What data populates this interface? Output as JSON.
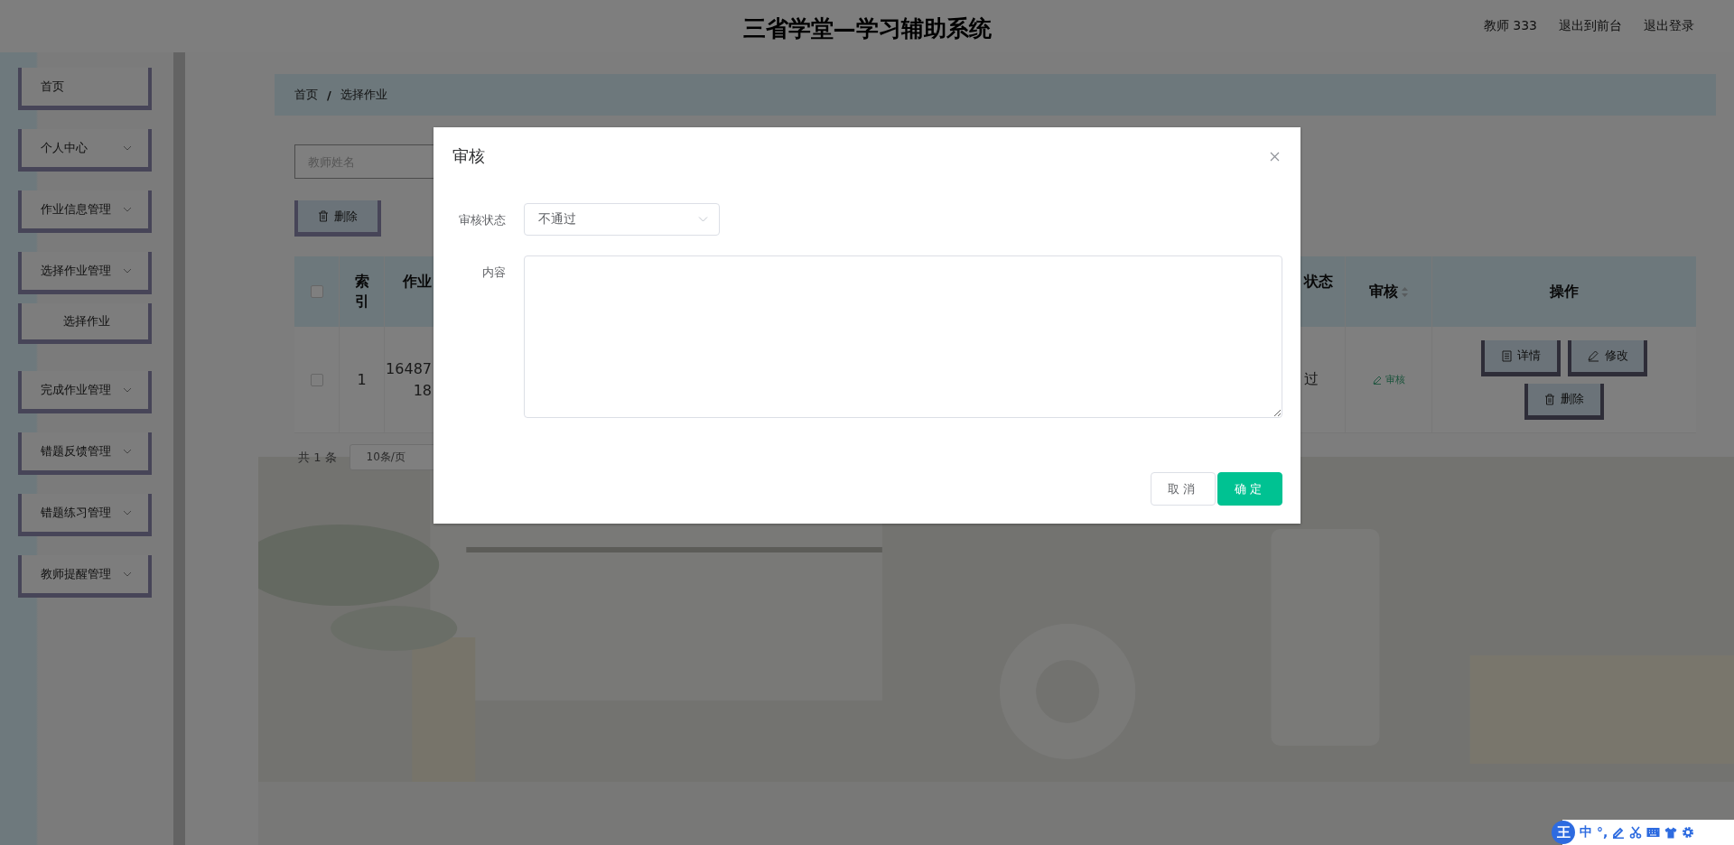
{
  "header": {
    "title": "三省学堂—学习辅助系统",
    "user": "教师 333",
    "links": [
      "退出到前台",
      "退出登录"
    ]
  },
  "sidebar": {
    "items": [
      {
        "label": "首页",
        "kind": "link"
      },
      {
        "label": "个人中心",
        "kind": "menu"
      },
      {
        "label": "作业信息管理",
        "kind": "menu"
      },
      {
        "label": "选择作业管理",
        "kind": "menu",
        "children": [
          {
            "label": "选择作业"
          }
        ]
      },
      {
        "label": "完成作业管理",
        "kind": "menu"
      },
      {
        "label": "错题反馈管理",
        "kind": "menu"
      },
      {
        "label": "错题练习管理",
        "kind": "menu"
      },
      {
        "label": "教师提醒管理",
        "kind": "menu"
      }
    ]
  },
  "breadcrumb": {
    "items": [
      "首页",
      "选择作业"
    ],
    "separator": "/"
  },
  "search": {
    "placeholder": "教师姓名"
  },
  "toolbar": {
    "delete_button": "删除"
  },
  "table": {
    "all_selected": false,
    "columns": [
      {
        "label": "索引",
        "sortable": false
      },
      {
        "label": "作业",
        "sortable": false
      },
      {
        "label": "状态",
        "sortable": false
      },
      {
        "label": "审核",
        "sortable": true
      },
      {
        "label": "操作",
        "sortable": false
      }
    ],
    "rows": [
      {
        "selected": false,
        "index": "1",
        "column_3": [
          "16487",
          "18"
        ],
        "column_4": "过",
        "review_link": "审核",
        "actions": [
          {
            "kind": "detail",
            "label": "详情"
          },
          {
            "kind": "edit",
            "label": "修改"
          },
          {
            "kind": "delete",
            "label": "删除"
          }
        ]
      }
    ]
  },
  "pagination": {
    "total": "共 1 条",
    "page_size": "10条/页"
  },
  "dialog": {
    "title": "审核",
    "fields": [
      {
        "label": "审核状态",
        "kind": "select",
        "value": "不通过"
      },
      {
        "label": "内容",
        "kind": "textarea"
      }
    ],
    "cancel": "取消",
    "confirm": "确定"
  },
  "ime_toolbar": {
    "logo": "王",
    "mode": "中",
    "punctuation": "°,"
  }
}
